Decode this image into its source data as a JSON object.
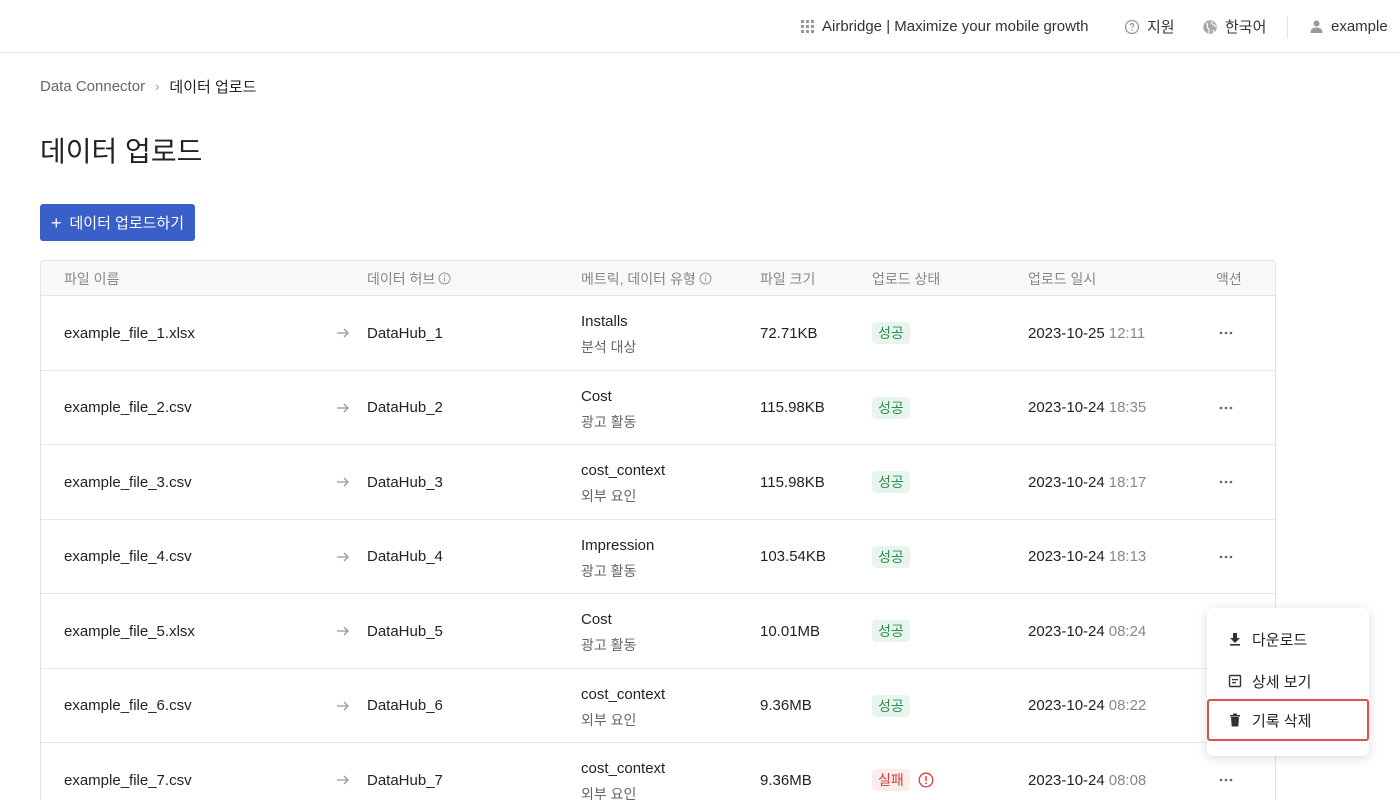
{
  "topbar": {
    "app_label": "Airbridge | Maximize your mobile growth",
    "support_label": "지원",
    "language_label": "한국어",
    "user_label": "example"
  },
  "breadcrumb": {
    "parent": "Data Connector",
    "separator": "›",
    "current": "데이터 업로드"
  },
  "page": {
    "title": "데이터 업로드",
    "upload_button_label": "데이터 업로드하기"
  },
  "table": {
    "columns": {
      "file_name": "파일 이름",
      "data_hub": "데이터 허브",
      "metric_type": "메트릭, 데이터 유형",
      "file_size": "파일 크기",
      "status": "업로드 상태",
      "uploaded_at": "업로드 일시",
      "action": "액션"
    },
    "rows": [
      {
        "file": "example_file_1.xlsx",
        "hub": "DataHub_1",
        "metric": "Installs",
        "type": "분석 대상",
        "size": "72.71KB",
        "status": "성공",
        "date": "2023-10-25",
        "time": "12:11"
      },
      {
        "file": "example_file_2.csv",
        "hub": "DataHub_2",
        "metric": "Cost",
        "type": "광고 활동",
        "size": "115.98KB",
        "status": "성공",
        "date": "2023-10-24",
        "time": "18:35"
      },
      {
        "file": "example_file_3.csv",
        "hub": "DataHub_3",
        "metric": "cost_context",
        "type": "외부 요인",
        "size": "115.98KB",
        "status": "성공",
        "date": "2023-10-24",
        "time": "18:17"
      },
      {
        "file": "example_file_4.csv",
        "hub": "DataHub_4",
        "metric": "Impression",
        "type": "광고 활동",
        "size": "103.54KB",
        "status": "성공",
        "date": "2023-10-24",
        "time": "18:13"
      },
      {
        "file": "example_file_5.xlsx",
        "hub": "DataHub_5",
        "metric": "Cost",
        "type": "광고 활동",
        "size": "10.01MB",
        "status": "성공",
        "date": "2023-10-24",
        "time": "08:24"
      },
      {
        "file": "example_file_6.csv",
        "hub": "DataHub_6",
        "metric": "cost_context",
        "type": "외부 요인",
        "size": "9.36MB",
        "status": "성공",
        "date": "2023-10-24",
        "time": "08:22"
      },
      {
        "file": "example_file_7.csv",
        "hub": "DataHub_7",
        "metric": "cost_context",
        "type": "외부 요인",
        "size": "9.36MB",
        "status": "실패",
        "date": "2023-10-24",
        "time": "08:08"
      }
    ]
  },
  "menu": {
    "download": "다운로드",
    "details": "상세 보기",
    "delete": "기록 삭제"
  },
  "colors": {
    "primary": "#3a5fc8",
    "success_bg": "#e7f5ec",
    "success_text": "#2e8b57",
    "fail_bg": "#fdecec",
    "fail_text": "#d93a3a",
    "highlight_border": "#e0504b"
  }
}
